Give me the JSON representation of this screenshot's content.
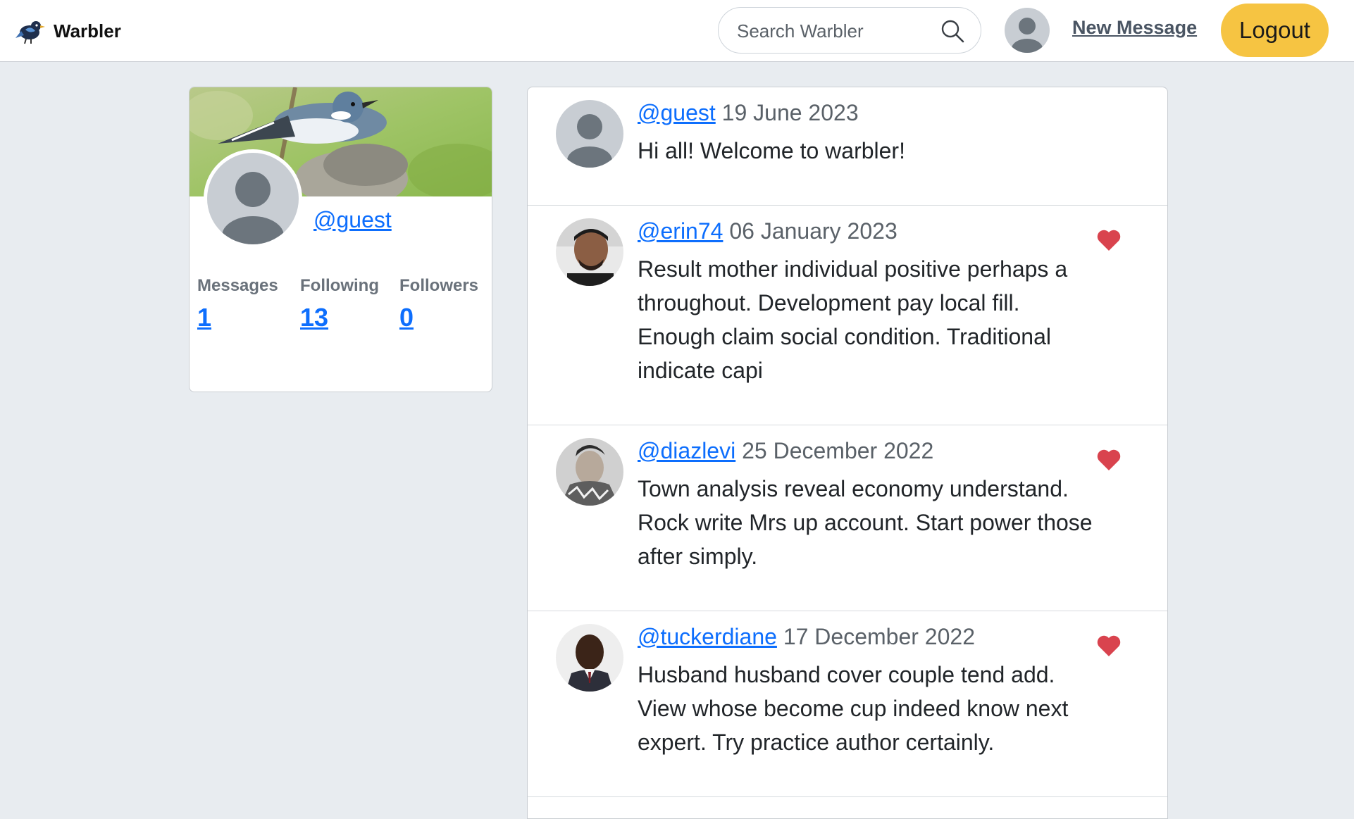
{
  "navbar": {
    "brand_name": "Warbler",
    "search_placeholder": "Search Warbler",
    "new_message_label": "New Message",
    "logout_label": "Logout"
  },
  "profile": {
    "handle": "@guest",
    "stats": [
      {
        "label": "Messages",
        "value": "1"
      },
      {
        "label": "Following",
        "value": "13"
      },
      {
        "label": "Followers",
        "value": "0"
      }
    ]
  },
  "messages": [
    {
      "user": "@guest",
      "date": "19 June 2023",
      "text": "Hi all! Welcome to warbler!",
      "liked": false,
      "avatar": "default-avatar"
    },
    {
      "user": "@erin74",
      "date": "06 January 2023",
      "text": "Result mother individual positive perhaps a throughout. Development pay local fill. Enough claim social condition. Traditional indicate capi",
      "liked": true,
      "avatar": "photo-avatar"
    },
    {
      "user": "@diazlevi",
      "date": "25 December 2022",
      "text": "Town analysis reveal economy understand. Rock write Mrs up account. Start power those after simply.",
      "liked": true,
      "avatar": "photo-avatar"
    },
    {
      "user": "@tuckerdiane",
      "date": "17 December 2022",
      "text": "Husband husband cover couple tend add. View whose become cup indeed know next expert. Try practice author certainly.",
      "liked": true,
      "avatar": "photo-avatar"
    }
  ],
  "colors": {
    "accent_link": "#0d6efd",
    "logout_button": "#f6c442",
    "like_heart": "#d9434e",
    "page_background": "#e8ecf0"
  }
}
